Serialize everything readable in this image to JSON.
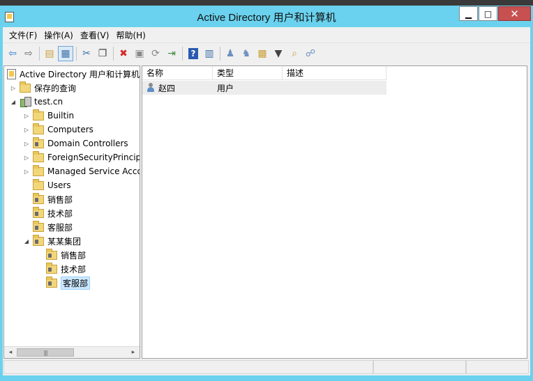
{
  "window": {
    "title": "Active Directory 用户和计算机",
    "buttons": {
      "minimize": "▁",
      "maximize": "□",
      "close": "✕"
    }
  },
  "menu": [
    "文件(F)",
    "操作(A)",
    "查看(V)",
    "帮助(H)"
  ],
  "toolbar": [
    {
      "name": "back-icon",
      "glyph": "⇦",
      "color": "#2a7bd4"
    },
    {
      "name": "forward-icon",
      "glyph": "⇨",
      "color": "#6b6b6b"
    },
    {
      "name": "up-folder-icon",
      "glyph": "▤",
      "color": "#c9a23a"
    },
    {
      "name": "show-tree-icon",
      "glyph": "▦",
      "color": "#3d6fa8"
    },
    {
      "name": "cut-icon",
      "glyph": "✂",
      "color": "#3d6fa8"
    },
    {
      "name": "copy-icon",
      "glyph": "❐",
      "color": "#444"
    },
    {
      "name": "delete-icon",
      "glyph": "✖",
      "color": "#d42a2a"
    },
    {
      "name": "properties-icon",
      "glyph": "▣",
      "color": "#888"
    },
    {
      "name": "refresh-icon",
      "glyph": "⟳",
      "color": "#888"
    },
    {
      "name": "export-icon",
      "glyph": "⇥",
      "color": "#3a8a3a"
    },
    {
      "name": "help-icon",
      "glyph": "?",
      "color": "#1f4fa0"
    },
    {
      "name": "view-icon",
      "glyph": "▥",
      "color": "#3d6fa8"
    },
    {
      "name": "new-user-icon",
      "glyph": "♟",
      "color": "#6b8fc0"
    },
    {
      "name": "new-group-icon",
      "glyph": "♞",
      "color": "#6b8fc0"
    },
    {
      "name": "new-ou-icon",
      "glyph": "▩",
      "color": "#c9a23a"
    },
    {
      "name": "filter-icon",
      "glyph": "▼",
      "color": "#444"
    },
    {
      "name": "find-icon",
      "glyph": "⌕",
      "color": "#c9a23a"
    },
    {
      "name": "delegate-icon",
      "glyph": "☍",
      "color": "#6b8fc0"
    }
  ],
  "tree": [
    {
      "label": "Active Directory 用户和计算机",
      "expander": "",
      "icon": "root",
      "level": 0
    },
    {
      "label": "保存的查询",
      "expander": "▷",
      "icon": "folder",
      "level": 1
    },
    {
      "label": "test.cn",
      "expander": "◢",
      "icon": "domain",
      "level": 1
    },
    {
      "label": "Builtin",
      "expander": "▷",
      "icon": "folder",
      "level": 2
    },
    {
      "label": "Computers",
      "expander": "▷",
      "icon": "folder",
      "level": 2
    },
    {
      "label": "Domain Controllers",
      "expander": "▷",
      "icon": "ou",
      "level": 2
    },
    {
      "label": "ForeignSecurityPrincipals",
      "expander": "▷",
      "icon": "folder",
      "level": 2
    },
    {
      "label": "Managed Service Accounts",
      "expander": "▷",
      "icon": "folder",
      "level": 2
    },
    {
      "label": "Users",
      "expander": "",
      "icon": "folder",
      "level": 2
    },
    {
      "label": "销售部",
      "expander": "",
      "icon": "ou",
      "level": 2
    },
    {
      "label": "技术部",
      "expander": "",
      "icon": "ou",
      "level": 2
    },
    {
      "label": "客服部",
      "expander": "",
      "icon": "ou",
      "level": 2
    },
    {
      "label": "某某集团",
      "expander": "◢",
      "icon": "ou",
      "level": 2
    },
    {
      "label": "销售部",
      "expander": "",
      "icon": "ou",
      "level": 3
    },
    {
      "label": "技术部",
      "expander": "",
      "icon": "ou",
      "level": 3
    },
    {
      "label": "客服部",
      "expander": "",
      "icon": "ou",
      "level": 3,
      "selected": true
    }
  ],
  "list": {
    "columns": [
      "名称",
      "类型",
      "描述"
    ],
    "rows": [
      {
        "name": "赵四",
        "type": "用户",
        "description": ""
      }
    ]
  },
  "scrollbar": {
    "left": "◂",
    "right": "▸",
    "thumb": "|||"
  }
}
